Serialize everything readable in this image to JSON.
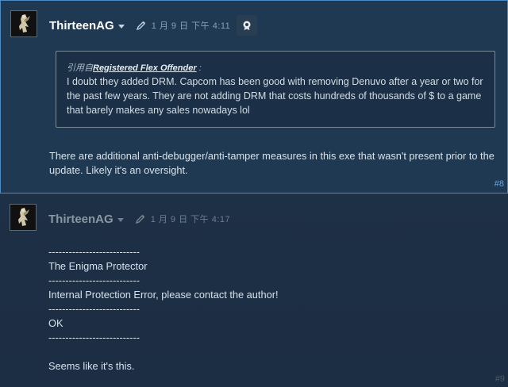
{
  "posts": [
    {
      "author": "ThirteenAG",
      "timestamp": "1 月 9 日 下午 4:11",
      "quote": {
        "prefix": "引用自",
        "author": "Registered Flex Offender",
        "suffix": ":",
        "text": "I doubt they added DRM. Capcom has been good with removing Denuvo after a year or two for the past few years. They are not adding DRM that costs hundreds of thousands of $ to a game that barely makes any sales nowadays lol"
      },
      "body": "There are additional anti-debugger/anti-tamper measures in this exe that wasn't present prior to the update. Likely it's an oversight.",
      "number": "#8"
    },
    {
      "author": "ThirteenAG",
      "timestamp": "1 月 9 日 下午 4:17",
      "body": "---------------------------\nThe Enigma Protector\n---------------------------\nInternal Protection Error, please contact the author!\n---------------------------\nOK\n---------------------------\n\nSeems like it's this.",
      "number": "#9"
    }
  ],
  "icons": {
    "caret": "chevron-down-icon",
    "edit": "pen-icon",
    "award": "award-icon"
  }
}
